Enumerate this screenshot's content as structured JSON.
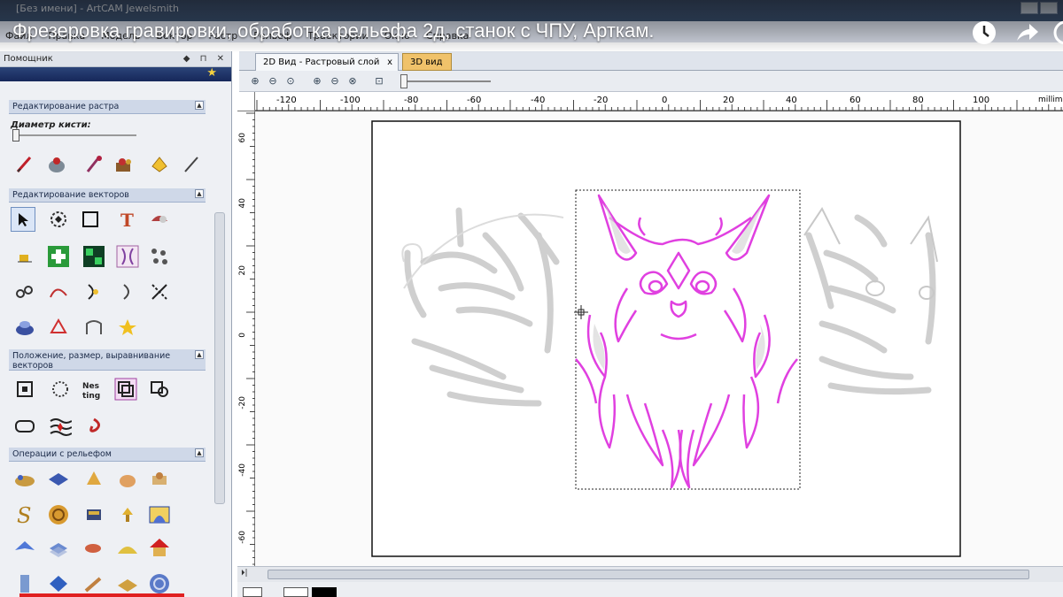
{
  "window": {
    "title": "[Без имени] - ArtCAM Jewelsmith"
  },
  "menu": [
    "Файл",
    "Правка",
    "Модель",
    "Вектор",
    "Растр",
    "Рельеф",
    "Траектории",
    "Окно",
    "Справка"
  ],
  "video": {
    "title": "Фрезеровка гравировки, обработка рельефа 2д, станок с ЧПУ, Арткам.",
    "icons": [
      "clock-icon",
      "share-icon",
      "info-icon"
    ]
  },
  "panel": {
    "title": "Помощник",
    "sections": {
      "raster_edit": "Редактирование растра",
      "brush_label": "Диаметр кисти:",
      "vector_edit": "Редактирование векторов",
      "position": "Положение, размер, выравнивание векторов",
      "relief_ops": "Операции с рельефом"
    }
  },
  "tabs": {
    "tab_2d": "2D Вид - Растровый слой",
    "tab_2d_close": "x",
    "tab_3d": "3D вид"
  },
  "ruler": {
    "h_ticks": [
      "-120",
      "-100",
      "-80",
      "-60",
      "-40",
      "-20",
      "0",
      "20",
      "40",
      "60",
      "80",
      "100"
    ],
    "h_unit": "millimet",
    "v_ticks": [
      "60",
      "40",
      "20",
      "0",
      "-20",
      "-40",
      "-60"
    ]
  },
  "colors": {
    "accent": "#e040e0",
    "ghost": "#cfcfcf",
    "panel_header": "#cfd8e8",
    "tab_3d": "#f0c26a"
  }
}
